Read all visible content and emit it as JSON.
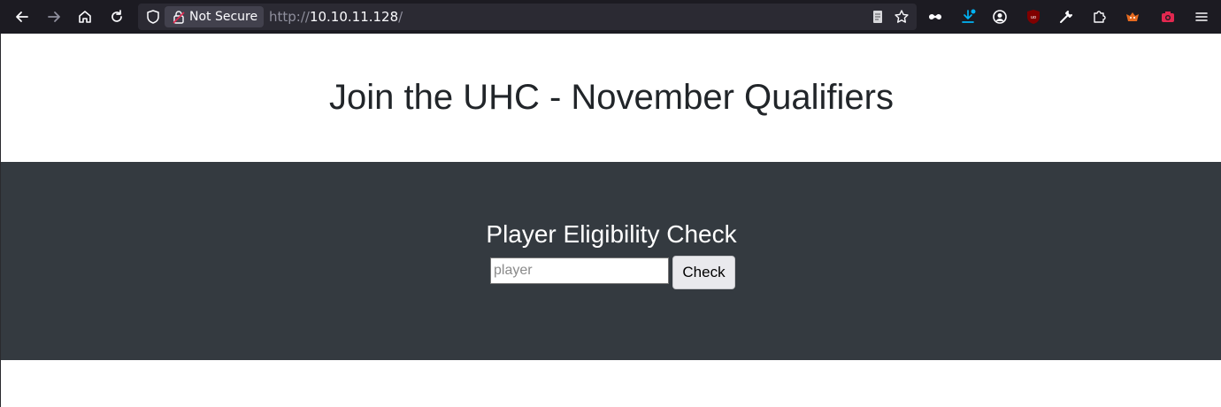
{
  "browser": {
    "security_label": "Not Secure",
    "url_scheme": "http://",
    "url_host": "10.10.11.128",
    "url_path": "/"
  },
  "page": {
    "title": "Join the UHC - November Qualifiers",
    "check_heading": "Player Eligibility Check",
    "player_placeholder": "player",
    "player_value": "",
    "check_label": "Check"
  },
  "colors": {
    "toolbar_bg": "#1c1b22",
    "jumbotron_bg": "#343a40",
    "title_text": "#212529"
  }
}
